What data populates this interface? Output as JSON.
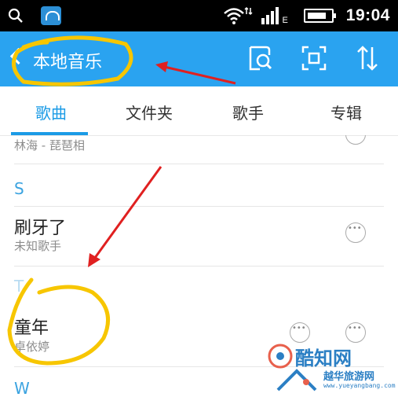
{
  "status_bar": {
    "time": "19:04",
    "network_type": "E",
    "icons": [
      "search-icon",
      "app-notification-icon",
      "wifi-icon",
      "signal-icon",
      "battery-icon"
    ]
  },
  "header": {
    "title": "本地音乐",
    "background_color": "#2aa3f0",
    "actions": [
      "scan-icon",
      "multi-select-icon",
      "sort-icon"
    ]
  },
  "tabs": [
    {
      "label": "歌曲",
      "active": true
    },
    {
      "label": "文件夹",
      "active": false
    },
    {
      "label": "歌手",
      "active": false
    },
    {
      "label": "专辑",
      "active": false
    }
  ],
  "songs": {
    "partial_subtitle": "林海 - 琵琶相",
    "section_s": "S",
    "song1_title": "刷牙了",
    "song1_artist": "未知歌手",
    "section_t": "T",
    "song2_title": "童年",
    "song2_artist": "卓依婷",
    "section_w": "W"
  },
  "watermark": {
    "line1": "酷知网",
    "line2": "越华旅游网",
    "url": "www.yueyangbang.com"
  },
  "colors": {
    "accent": "#1b9be6",
    "annotation_highlight": "#f7c600",
    "annotation_arrow": "#e02020"
  }
}
